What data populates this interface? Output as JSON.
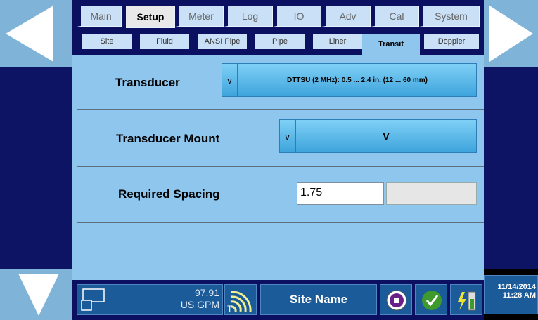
{
  "main_tabs": [
    {
      "label": "Main",
      "active": false
    },
    {
      "label": "Setup",
      "active": true
    },
    {
      "label": "Meter",
      "active": false
    },
    {
      "label": "Log",
      "active": false
    },
    {
      "label": "IO",
      "active": false
    },
    {
      "label": "Adv",
      "active": false
    },
    {
      "label": "Cal",
      "active": false
    },
    {
      "label": "System",
      "active": false
    }
  ],
  "sub_tabs": [
    {
      "label": "Site",
      "active": false
    },
    {
      "label": "Fluid",
      "active": false
    },
    {
      "label": "ANSI Pipe",
      "active": false
    },
    {
      "label": "Pipe",
      "active": false
    },
    {
      "label": "Liner",
      "active": false
    },
    {
      "label": "Transit",
      "active": true
    },
    {
      "label": "Doppler",
      "active": false
    }
  ],
  "transducer": {
    "label": "Transducer",
    "dropdown_symbol": "v",
    "value": "DTTSU (2 MHz): 0.5 ... 2.4 in. (12 ... 60 mm)"
  },
  "mount": {
    "label": "Transducer Mount",
    "dropdown_symbol": "v",
    "value": "V"
  },
  "spacing": {
    "label": "Required Spacing",
    "value": "1.75",
    "secondary_value": ""
  },
  "status": {
    "flow_value": "97.91",
    "flow_unit": "US GPM",
    "signal_letter": "T",
    "site_name": "Site Name",
    "date": "11/14/2014",
    "time": "11:28 AM"
  },
  "colors": {
    "navy": "#0b1061",
    "panel": "#8ec6ee",
    "button": "#3ea4dc",
    "status_cell": "#1b5b9a"
  },
  "icons": [
    "left-arrow-icon",
    "right-arrow-icon",
    "down-arrow-icon",
    "window-icon",
    "signal-icon",
    "record-icon",
    "check-icon",
    "battery-power-icon"
  ]
}
